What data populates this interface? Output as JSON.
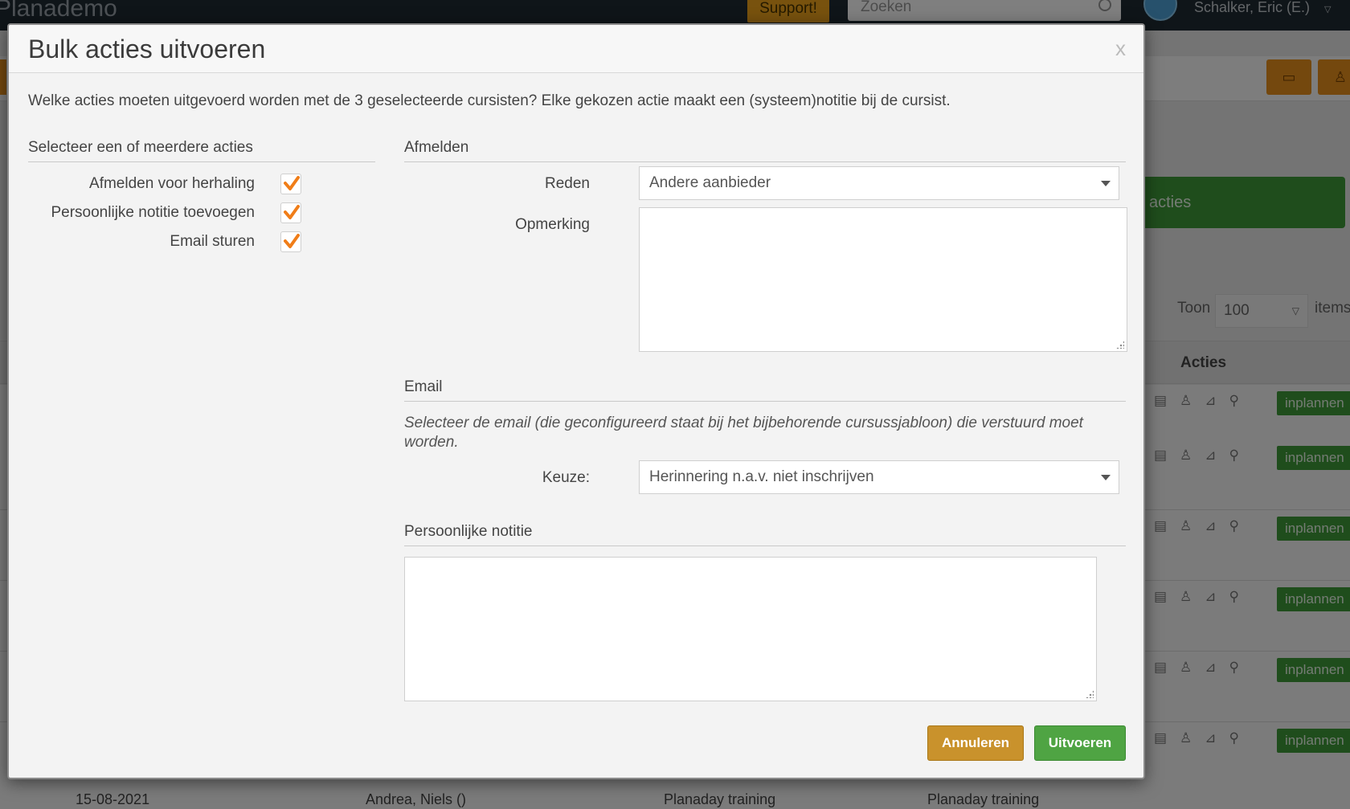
{
  "background": {
    "brand": "Planademo",
    "support_label": "Support!",
    "search_placeholder": "Zoeken",
    "user_name": "Schalker, Eric (E.)",
    "bulk_button_label": "acties",
    "toon_label": "Toon",
    "toon_value": "100",
    "items_label": "items",
    "table_col_acties": "Acties",
    "row_button_label": "inplannen",
    "last_row": {
      "date": "15-08-2021",
      "name": "Andrea, Niels ()",
      "course1": "Planaday training",
      "course2": "Planaday training"
    }
  },
  "modal": {
    "title": "Bulk acties uitvoeren",
    "close_label": "x",
    "intro": "Welke acties moeten uitgevoerd worden met de 3 geselecteerde cursisten? Elke gekozen actie maakt een (systeem)notitie bij de cursist.",
    "left_section_title": "Selecteer een of meerdere acties",
    "actions": [
      {
        "label": "Afmelden voor herhaling",
        "checked": true
      },
      {
        "label": "Persoonlijke notitie toevoegen",
        "checked": true
      },
      {
        "label": "Email sturen",
        "checked": true
      }
    ],
    "afmelden": {
      "title": "Afmelden",
      "reden_label": "Reden",
      "reden_value": "Andere aanbieder",
      "opmerking_label": "Opmerking",
      "opmerking_value": ""
    },
    "email": {
      "title": "Email",
      "description": "Selecteer de email (die geconfigureerd staat bij het bijbehorende cursussjabloon) die verstuurd moet worden.",
      "keuze_label": "Keuze:",
      "keuze_value": "Herinnering n.a.v. niet inschrijven"
    },
    "notitie": {
      "title": "Persoonlijke notitie",
      "value": ""
    },
    "cancel_label": "Annuleren",
    "submit_label": "Uitvoeren"
  },
  "colors": {
    "accent_orange": "#e8901c",
    "checkmark": "#f07d18",
    "cancel_button": "#c9922c",
    "submit_button": "#4fa443"
  }
}
